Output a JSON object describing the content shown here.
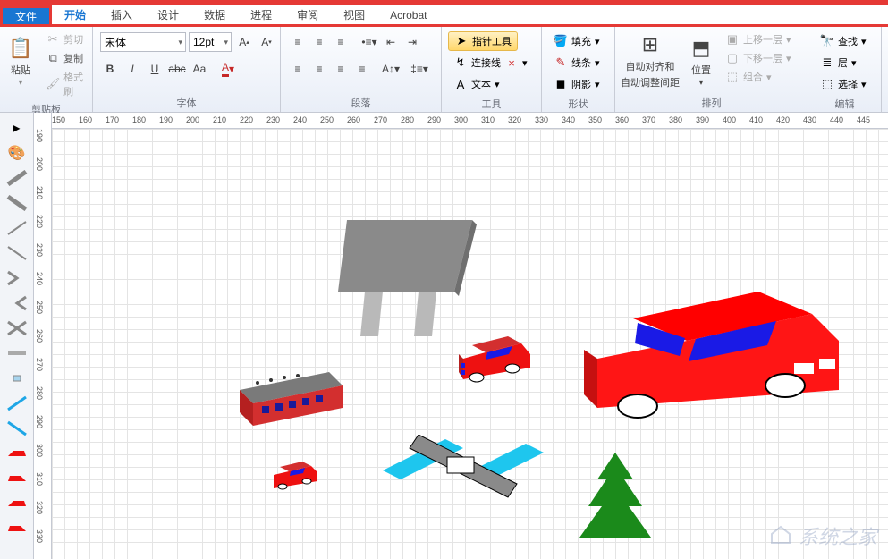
{
  "menubar": {
    "tabs": [
      "文件",
      "开始",
      "插入",
      "设计",
      "数据",
      "进程",
      "审阅",
      "视图",
      "Acrobat"
    ],
    "active": 1,
    "highlighted": 0
  },
  "ribbon": {
    "clipboard": {
      "label": "剪贴板",
      "paste": "粘贴",
      "cut": "剪切",
      "copy": "复制",
      "format_painter": "格式刷"
    },
    "font": {
      "label": "字体",
      "family": "宋体",
      "size": "12pt"
    },
    "paragraph": {
      "label": "段落"
    },
    "tools": {
      "label": "工具",
      "pointer": "指针工具",
      "connector": "连接线",
      "text": "文本"
    },
    "shapes": {
      "label": "形状",
      "fill": "填充",
      "line": "线条",
      "shadow": "阴影"
    },
    "arrange": {
      "label": "排列",
      "auto_align": "自动对齐和",
      "auto_adjust": "自动调整间距",
      "position": "位置",
      "bring_forward": "上移一层",
      "send_backward": "下移一层",
      "group": "组合"
    },
    "editing": {
      "label": "编辑",
      "find": "查找",
      "layers": "层",
      "select": "选择"
    }
  },
  "ruler": {
    "h_values": [
      "150",
      "160",
      "170",
      "180",
      "190",
      "200",
      "210",
      "220",
      "230",
      "240",
      "250",
      "260",
      "270",
      "280",
      "290",
      "300",
      "310",
      "320",
      "330",
      "340",
      "350",
      "360",
      "370",
      "380",
      "390",
      "400",
      "410",
      "420",
      "430",
      "440",
      "445"
    ],
    "v_values": [
      "190",
      "200",
      "210",
      "220",
      "230",
      "240",
      "250",
      "260",
      "270",
      "280",
      "290",
      "300",
      "310",
      "320",
      "330"
    ]
  },
  "canvas_objects": [
    {
      "name": "billboard",
      "type": "3d-sign",
      "color": "#808080"
    },
    {
      "name": "bus",
      "type": "3d-vehicle",
      "color": "#d32f2f"
    },
    {
      "name": "small-car-1",
      "type": "3d-car",
      "color": "#d32f2f"
    },
    {
      "name": "small-car-2",
      "type": "3d-car-tiny",
      "color": "#d32f2f"
    },
    {
      "name": "large-car",
      "type": "3d-car-large",
      "color": "#ff0000"
    },
    {
      "name": "intersection",
      "type": "road-cross"
    },
    {
      "name": "tree",
      "type": "pine-tree",
      "color": "#1b8a1b"
    }
  ],
  "watermark": "系统之家"
}
